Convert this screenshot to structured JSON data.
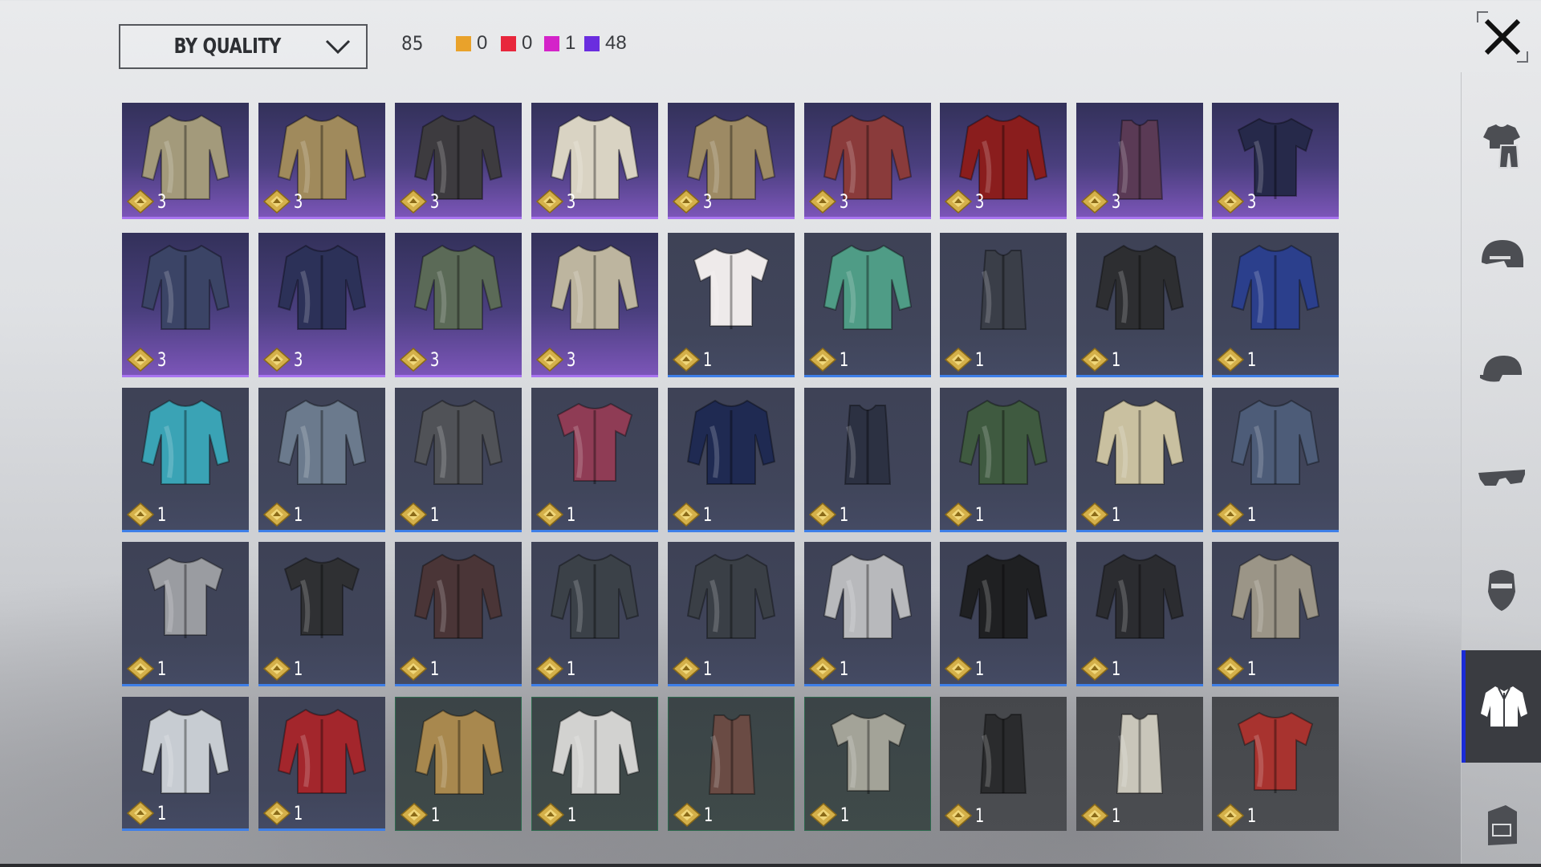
{
  "toolbar": {
    "sort_label": "BY QUALITY",
    "total_count": "85",
    "quality_counts": [
      {
        "color": "#e9a22b",
        "value": "0"
      },
      {
        "color": "#e8263c",
        "value": "0"
      },
      {
        "color": "#d423c9",
        "value": "1"
      },
      {
        "color": "#6a2ddf",
        "value": "48"
      }
    ]
  },
  "close": {
    "icon": "close-icon"
  },
  "sidebar": {
    "items": [
      {
        "name": "outfit-icon",
        "active": false
      },
      {
        "name": "helmet-icon",
        "active": false
      },
      {
        "name": "cap-icon",
        "active": false
      },
      {
        "name": "glasses-icon",
        "active": false
      },
      {
        "name": "mask-icon",
        "active": false
      },
      {
        "name": "jacket-icon",
        "active": true
      },
      {
        "name": "backpack-icon",
        "active": false
      }
    ]
  },
  "items": [
    {
      "quality": "epic",
      "count": "3",
      "name": "khaki-military-shirt",
      "color": "#a39a7b"
    },
    {
      "quality": "epic",
      "count": "3",
      "name": "tan-bomber-jacket",
      "color": "#a08a5c"
    },
    {
      "quality": "epic",
      "count": "3",
      "name": "leather-vest-jacket",
      "color": "#3d3b3f"
    },
    {
      "quality": "epic",
      "count": "3",
      "name": "white-blouse",
      "color": "#d9d3c3"
    },
    {
      "quality": "epic",
      "count": "3",
      "name": "plaid-blazer",
      "color": "#9d8a64"
    },
    {
      "quality": "epic",
      "count": "3",
      "name": "floral-shirt",
      "color": "#8a3b3b"
    },
    {
      "quality": "epic",
      "count": "3",
      "name": "red-black-jacket",
      "color": "#8a1d1d"
    },
    {
      "quality": "epic",
      "count": "3",
      "name": "pink-leather-vest",
      "color": "#5a3a55"
    },
    {
      "quality": "epic",
      "count": "3",
      "name": "navy-sailor-top",
      "color": "#26294a"
    },
    {
      "quality": "epic",
      "count": "3",
      "name": "striped-vest-shirt",
      "color": "#3b4466"
    },
    {
      "quality": "epic",
      "count": "3",
      "name": "navy-waistcoat",
      "color": "#2c3158"
    },
    {
      "quality": "epic",
      "count": "3",
      "name": "green-sweater",
      "color": "#5b6a57"
    },
    {
      "quality": "epic",
      "count": "3",
      "name": "beige-blazer",
      "color": "#bdb59f"
    },
    {
      "quality": "rare",
      "count": "1",
      "name": "paint-splatter-tee",
      "color": "#eeeaea"
    },
    {
      "quality": "rare",
      "count": "1",
      "name": "tropical-shirt",
      "color": "#4f9c86"
    },
    {
      "quality": "rare",
      "count": "1",
      "name": "tank-top",
      "color": "#3a3e48"
    },
    {
      "quality": "rare",
      "count": "1",
      "name": "black-leather-jacket",
      "color": "#2d2e31"
    },
    {
      "quality": "rare",
      "count": "1",
      "name": "varsity-jacket",
      "color": "#2b3f8c"
    },
    {
      "quality": "rare",
      "count": "1",
      "name": "teal-hoodie",
      "color": "#3aa3b5"
    },
    {
      "quality": "rare",
      "count": "1",
      "name": "denim-jacket",
      "color": "#6b7a8d"
    },
    {
      "quality": "rare",
      "count": "1",
      "name": "grey-track-jacket",
      "color": "#505257"
    },
    {
      "quality": "rare",
      "count": "1",
      "name": "rock-tee",
      "color": "#8f3c55"
    },
    {
      "quality": "rare",
      "count": "1",
      "name": "navy-plaid-shirt",
      "color": "#1f2a52"
    },
    {
      "quality": "rare",
      "count": "1",
      "name": "pare-tank",
      "color": "#2c3142"
    },
    {
      "quality": "rare",
      "count": "1",
      "name": "green-vest-shirt",
      "color": "#3f5a40"
    },
    {
      "quality": "rare",
      "count": "1",
      "name": "camo-shirt",
      "color": "#c9c0a0"
    },
    {
      "quality": "rare",
      "count": "1",
      "name": "blue-denim-jacket",
      "color": "#4d5c78"
    },
    {
      "quality": "rare",
      "count": "1",
      "name": "grey-raglan-tee",
      "color": "#9a9ca1"
    },
    {
      "quality": "rare",
      "count": "1",
      "name": "black-raglan-tee",
      "color": "#2f3033"
    },
    {
      "quality": "rare",
      "count": "1",
      "name": "brown-puffer",
      "color": "#4a3537"
    },
    {
      "quality": "rare",
      "count": "1",
      "name": "dark-hooded-jacket",
      "color": "#3b4148"
    },
    {
      "quality": "rare",
      "count": "1",
      "name": "camo-hooded-jacket",
      "color": "#3a3f46"
    },
    {
      "quality": "rare",
      "count": "1",
      "name": "white-puffer",
      "color": "#b8b9bc"
    },
    {
      "quality": "rare",
      "count": "1",
      "name": "black-blazer",
      "color": "#1f2022"
    },
    {
      "quality": "rare",
      "count": "1",
      "name": "black-shirt",
      "color": "#2b2c30"
    },
    {
      "quality": "rare",
      "count": "1",
      "name": "khaki-shirt",
      "color": "#9b9587"
    },
    {
      "quality": "rare",
      "count": "1",
      "name": "white-plaid-shirt",
      "color": "#c7ccd2"
    },
    {
      "quality": "rare",
      "count": "1",
      "name": "red-plaid-shirt",
      "color": "#a3262c"
    },
    {
      "quality": "uncommon",
      "count": "1",
      "name": "yellow-quilted-jacket",
      "color": "#a8884e"
    },
    {
      "quality": "uncommon",
      "count": "1",
      "name": "white-dress-shirt",
      "color": "#d2d2d0"
    },
    {
      "quality": "uncommon",
      "count": "1",
      "name": "brown-vest",
      "color": "#6a4b44"
    },
    {
      "quality": "uncommon",
      "count": "1",
      "name": "grey-tee",
      "color": "#a3a398"
    },
    {
      "quality": "common",
      "count": "1",
      "name": "black-tank",
      "color": "#2a2b2d"
    },
    {
      "quality": "common",
      "count": "1",
      "name": "white-tank",
      "color": "#c9c6ba"
    },
    {
      "quality": "common",
      "count": "1",
      "name": "red-tee",
      "color": "#a8332f"
    }
  ]
}
